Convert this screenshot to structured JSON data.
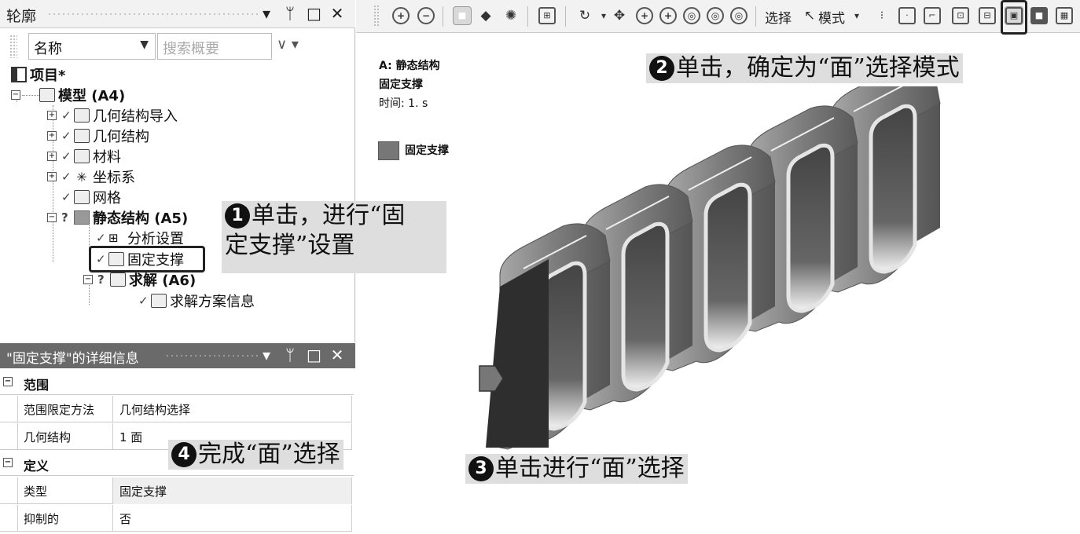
{
  "outline": {
    "title": "轮廓",
    "win_pin": "ᛘ",
    "win_max": "□",
    "win_close": "✕",
    "win_menu": "▾",
    "filter_value": "名称",
    "search_placeholder": "搜索概要",
    "tree": {
      "project": "项目*",
      "model": "模型 (A4)",
      "geometry_import": "几何结构导入",
      "geometry": "几何结构",
      "materials": "材料",
      "coord": "坐标系",
      "mesh": "网格",
      "static": "静态结构 (A5)",
      "analysis_settings": "分析设置",
      "fixed_support": "固定支撑",
      "solution": "求解 (A6)",
      "solution_info": "求解方案信息"
    }
  },
  "details": {
    "title": "\"固定支撑\"的详细信息",
    "sec_scope": "范围",
    "scoping_method_label": "范围限定方法",
    "scoping_method_value": "几何结构选择",
    "geometry_label": "几何结构",
    "geometry_value": "1 面",
    "sec_definition": "定义",
    "type_label": "类型",
    "type_value": "固定支撑",
    "suppressed_label": "抑制的",
    "suppressed_value": "否"
  },
  "toolbar": {
    "select_label": "选择",
    "mode_label": "模式"
  },
  "viewport": {
    "info_title": "A: 静态结构",
    "info_sub": "固定支撑",
    "info_time": "时间: 1. s",
    "legend_label": "固定支撑",
    "legend_color": "#777777"
  },
  "callouts": {
    "c1_num": "1",
    "c1_line1": "单击，进行“固",
    "c1_line2": "定支撑”设置",
    "c2_num": "2",
    "c2_text": "单击，确定为“面”选择模式",
    "c3_num": "3",
    "c3_text": "单击进行“面”选择",
    "c4_num": "4",
    "c4_text": "完成“面”选择"
  }
}
